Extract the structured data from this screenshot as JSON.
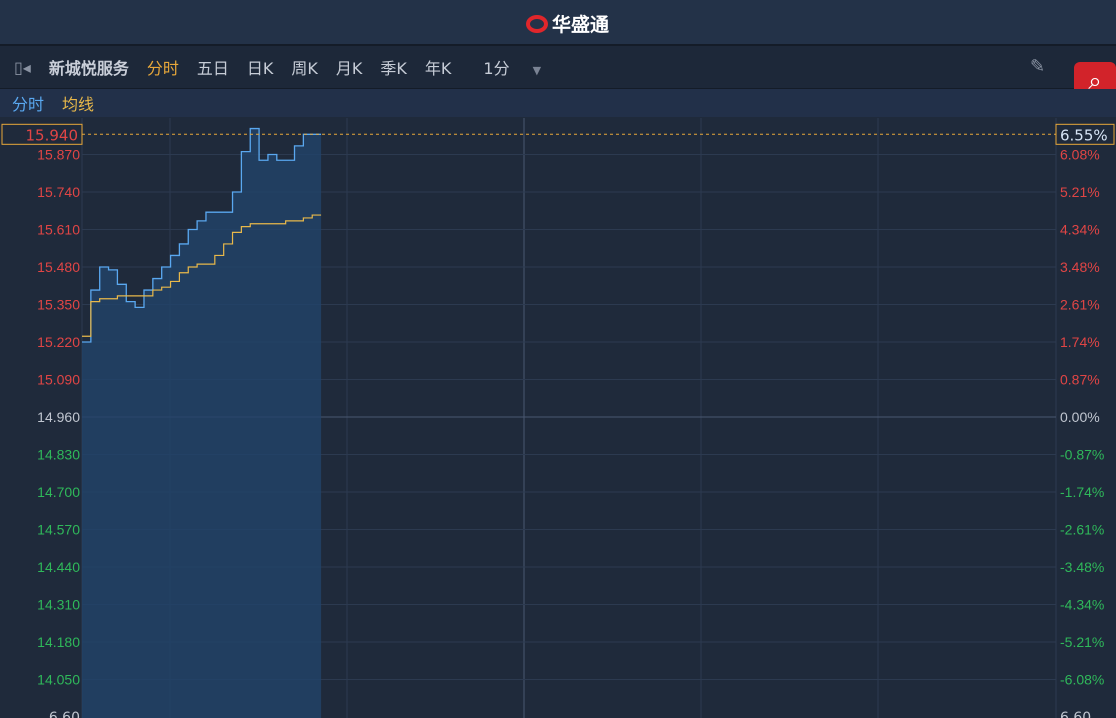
{
  "header": {
    "brand": "华盛通"
  },
  "toolbar": {
    "stock_name": "新城悦服务",
    "tabs": [
      "分时",
      "五日",
      "日K",
      "周K",
      "月K",
      "季K",
      "年K"
    ],
    "interval": "1分"
  },
  "legend": {
    "price": "分时",
    "avg": "均线"
  },
  "colors": {
    "up": "#e04545",
    "down": "#2fb85a",
    "flat": "#c0c6d0",
    "price_line": "#5aa8f0",
    "avg_line": "#e8b84a",
    "accent": "#e8a83a"
  },
  "chart_data": {
    "type": "line",
    "prev_close": 14.96,
    "ylim": [
      13.95,
      15.98
    ],
    "current_price": "15.940",
    "current_pct": "6.55%",
    "price_ticks": [
      "15.870",
      "15.740",
      "15.610",
      "15.480",
      "15.350",
      "15.220",
      "15.090",
      "14.960",
      "14.830",
      "14.700",
      "14.570",
      "14.440",
      "14.310",
      "14.180",
      "14.050"
    ],
    "pct_ticks": [
      "6.08%",
      "5.21%",
      "4.34%",
      "3.48%",
      "2.61%",
      "1.74%",
      "0.87%",
      "0.00%",
      "-0.87%",
      "-1.74%",
      "-2.61%",
      "-3.48%",
      "-4.34%",
      "-5.21%",
      "-6.08%"
    ],
    "bottom_label_left": "6.60",
    "bottom_label_right": "6.60",
    "minutes_total": 330,
    "series": [
      {
        "name": "分时",
        "values": [
          15.22,
          15.4,
          15.48,
          15.47,
          15.42,
          15.36,
          15.34,
          15.4,
          15.44,
          15.48,
          15.52,
          15.56,
          15.61,
          15.64,
          15.67,
          15.67,
          15.67,
          15.74,
          15.88,
          15.96,
          15.85,
          15.87,
          15.85,
          15.85,
          15.9,
          15.94,
          15.94
        ]
      },
      {
        "name": "均线",
        "values": [
          15.24,
          15.36,
          15.37,
          15.37,
          15.38,
          15.38,
          15.38,
          15.38,
          15.4,
          15.41,
          15.43,
          15.46,
          15.48,
          15.49,
          15.49,
          15.52,
          15.56,
          15.6,
          15.62,
          15.63,
          15.63,
          15.63,
          15.63,
          15.64,
          15.64,
          15.65,
          15.66
        ]
      }
    ]
  }
}
